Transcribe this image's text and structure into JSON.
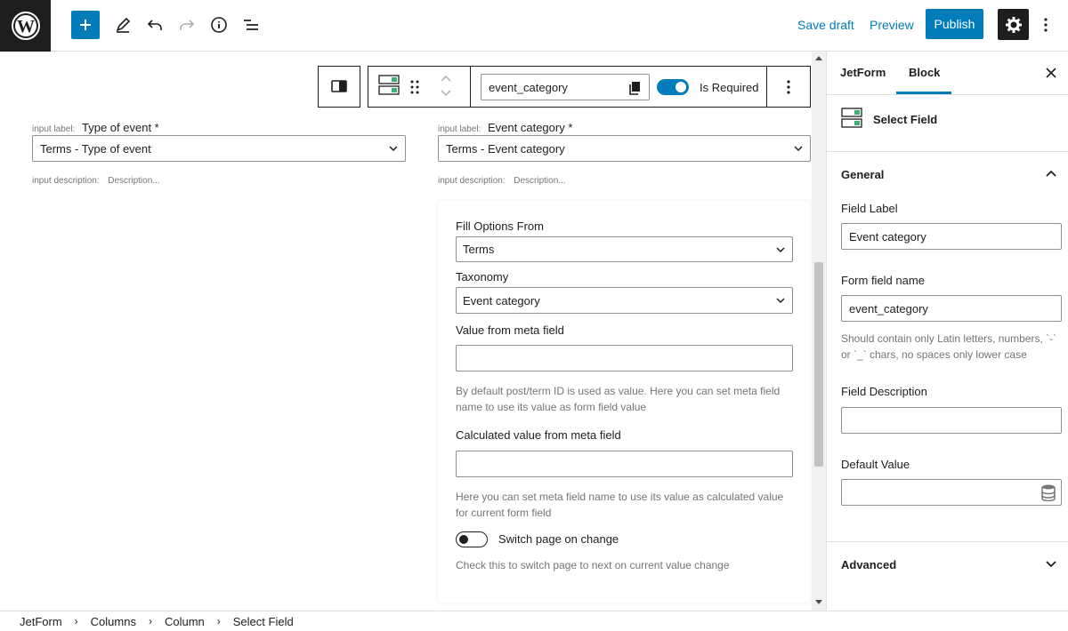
{
  "topbar": {
    "save_draft": "Save draft",
    "preview": "Preview",
    "publish": "Publish"
  },
  "block_toolbar": {
    "field_name_value": "event_category",
    "toggle_label": "Is Required",
    "toggle_on": true
  },
  "fields": [
    {
      "label_prefix": "input label:",
      "label": "Type of event *",
      "select_value": "Terms - Type of event",
      "desc_prefix": "input description:",
      "desc_placeholder": "Description..."
    },
    {
      "label_prefix": "input label:",
      "label": "Event category *",
      "select_value": "Terms - Event category",
      "desc_prefix": "input description:",
      "desc_placeholder": "Description..."
    }
  ],
  "panel": {
    "fill_options_label": "Fill Options From",
    "fill_options_value": "Terms",
    "taxonomy_label": "Taxonomy",
    "taxonomy_value": "Event category",
    "meta_value_label": "Value from meta field",
    "meta_value_help": "By default post/term ID is used as value. Here you can set meta field name to use its value as form field value",
    "calc_label": "Calculated value from meta field",
    "calc_help": "Here you can set meta field name to use its value as calculated value for current form field",
    "switch_label": "Switch page on change",
    "switch_on": false,
    "switch_help": "Check this to switch page to next on current value change"
  },
  "sidebar": {
    "tab_jetform": "JetForm",
    "tab_block": "Block",
    "block_name": "Select Field",
    "general_title": "General",
    "field_label_label": "Field Label",
    "field_label_value": "Event category",
    "form_field_name_label": "Form field name",
    "form_field_name_value": "event_category",
    "form_field_name_help": "Should contain only Latin letters, numbers, `-` or `_` chars, no spaces only lower case",
    "field_desc_label": "Field Description",
    "field_desc_value": "",
    "default_value_label": "Default Value",
    "default_value_value": "",
    "advanced_title": "Advanced"
  },
  "breadcrumb": [
    "JetForm",
    "Columns",
    "Column",
    "Select Field"
  ],
  "colors": {
    "accent": "#007cba",
    "dark": "#1e1e1e",
    "muted": "#757575"
  }
}
